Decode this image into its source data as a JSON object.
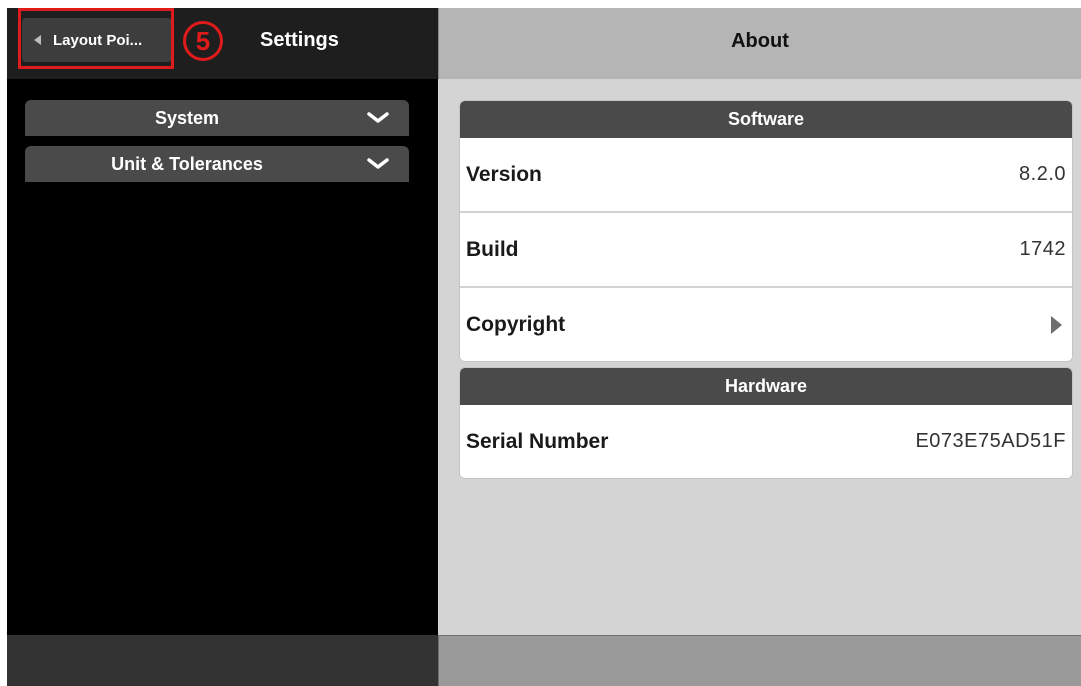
{
  "left": {
    "back_button_label": "Layout Poi...",
    "step_number": "5",
    "title": "Settings",
    "sections": [
      {
        "label": "System"
      },
      {
        "label": "Unit & Tolerances"
      }
    ]
  },
  "right": {
    "title": "About",
    "software": {
      "header": "Software",
      "rows": [
        {
          "key": "Version",
          "value": "8.2.0"
        },
        {
          "key": "Build",
          "value": "1742"
        },
        {
          "key": "Copyright",
          "value": ""
        }
      ]
    },
    "hardware": {
      "header": "Hardware",
      "rows": [
        {
          "key": "Serial Number",
          "value": "E073E75AD51F"
        }
      ]
    }
  },
  "colors": {
    "highlight": "#e01b1b",
    "section_header": "#4a4a4a",
    "left_bg": "#000000",
    "right_bg": "#d4d4d4"
  }
}
